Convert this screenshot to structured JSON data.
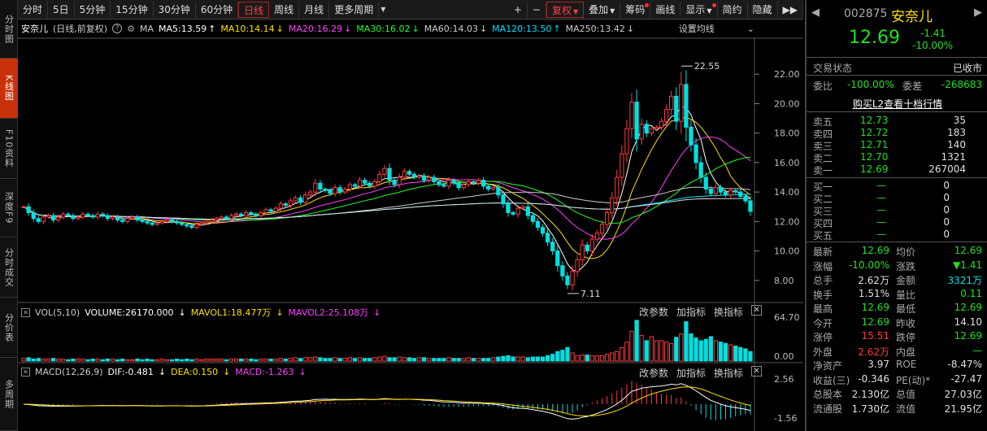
{
  "left_tabs": [
    {
      "label": "分时图",
      "active": false
    },
    {
      "label": "K线图",
      "active": true
    },
    {
      "label": "F10资料",
      "active": false
    },
    {
      "label": "深度F9",
      "active": false
    },
    {
      "label": "分时成交",
      "active": false
    },
    {
      "label": "分价表",
      "active": false
    },
    {
      "label": "多周期",
      "active": false
    }
  ],
  "toolbar": {
    "periods": [
      "分时",
      "5日",
      "5分钟",
      "15分钟",
      "30分钟",
      "60分钟",
      "日线",
      "周线",
      "月线",
      "更多周期"
    ],
    "active_period": "日线",
    "plus": "+",
    "minus": "−",
    "tools": [
      "复权",
      "叠加",
      "筹码",
      "画线",
      "显示",
      "简约",
      "隐藏"
    ],
    "expand": "▶▶"
  },
  "ma_legend": {
    "name": "安奈儿",
    "mode": "(日线,前复权)",
    "ma_label": "MA",
    "items": [
      {
        "text": "MA5:13.59",
        "arrow": "↑",
        "color": "#ffffff"
      },
      {
        "text": "MA10:14.14",
        "arrow": "↓",
        "color": "#ffe000"
      },
      {
        "text": "MA20:16.29",
        "arrow": "↓",
        "color": "#ff40ff"
      },
      {
        "text": "MA30:16.02",
        "arrow": "↓",
        "color": "#20ff20"
      },
      {
        "text": "MA60:14.03",
        "arrow": "↓",
        "color": "#cccccc"
      },
      {
        "text": "MA120:13.50",
        "arrow": "↑",
        "color": "#00e0ff"
      },
      {
        "text": "MA250:13.42",
        "arrow": "↓",
        "color": "#cccccc"
      }
    ],
    "settings": "设置均线"
  },
  "price_axis": [
    "22.00",
    "20.00",
    "18.00",
    "16.00",
    "14.00",
    "12.00",
    "10.00",
    "8.00"
  ],
  "annotations": {
    "high": "22.55",
    "low": "7.11"
  },
  "vol_panel": {
    "title": "VOL(5,10)",
    "volume": "VOLUME:26170.000",
    "mavol1": "MAVOL1:18.477万",
    "mavol2": "MAVOL2:25.108万",
    "axis_top": "64.70",
    "axis_bottom": "0.00"
  },
  "macd_panel": {
    "title": "MACD(12,26,9)",
    "dif": "DIF:-0.481",
    "dea": "DEA:0.150",
    "macd": "MACD:-1.263",
    "axis_top": "2.56",
    "axis_bottom": "-1.56"
  },
  "panel_buttons": [
    "改参数",
    "加指标",
    "换指标"
  ],
  "panel_close": "✕",
  "stock": {
    "code": "002875",
    "name": "安奈儿",
    "price": "12.69",
    "change": "-1.41",
    "pct": "-10.00%"
  },
  "status": {
    "label": "交易状态",
    "value": "已收市"
  },
  "weibi": {
    "label1": "委比",
    "val1": "-100.00%",
    "label2": "委差",
    "val2": "-268683"
  },
  "l2_button": "购买L2查看十档行情",
  "sell": [
    {
      "label": "卖五",
      "price": "12.73",
      "vol": "35"
    },
    {
      "label": "卖四",
      "price": "12.72",
      "vol": "183"
    },
    {
      "label": "卖三",
      "price": "12.71",
      "vol": "140"
    },
    {
      "label": "卖二",
      "price": "12.70",
      "vol": "1321"
    },
    {
      "label": "卖一",
      "price": "12.69",
      "vol": "267004"
    }
  ],
  "buy": [
    {
      "label": "买一",
      "price": "—",
      "vol": "0"
    },
    {
      "label": "买二",
      "price": "—",
      "vol": "0"
    },
    {
      "label": "买三",
      "price": "—",
      "vol": "0"
    },
    {
      "label": "买四",
      "price": "—",
      "vol": "0"
    },
    {
      "label": "买五",
      "price": "—",
      "vol": "0"
    }
  ],
  "stats": [
    [
      {
        "l": "最新",
        "v": "12.69",
        "c": "green"
      },
      {
        "l": "均价",
        "v": "12.69",
        "c": "green"
      }
    ],
    [
      {
        "l": "涨幅",
        "v": "-10.00%",
        "c": "green"
      },
      {
        "l": "涨跌",
        "v": "▼1.41",
        "c": "green"
      }
    ],
    [
      {
        "l": "总手",
        "v": "2.62万",
        "c": "white"
      },
      {
        "l": "金额",
        "v": "3321万",
        "c": "cyan"
      }
    ],
    [
      {
        "l": "换手",
        "v": "1.51%",
        "c": "white"
      },
      {
        "l": "量比",
        "v": "0.11",
        "c": "green"
      }
    ],
    [
      {
        "l": "最高",
        "v": "12.69",
        "c": "green"
      },
      {
        "l": "最低",
        "v": "12.69",
        "c": "green"
      }
    ],
    [
      {
        "l": "今开",
        "v": "12.69",
        "c": "green"
      },
      {
        "l": "昨收",
        "v": "14.10",
        "c": "white"
      }
    ],
    [
      {
        "l": "涨停",
        "v": "15.51",
        "c": "red"
      },
      {
        "l": "跌停",
        "v": "12.69",
        "c": "green"
      }
    ],
    [
      {
        "l": "外盘",
        "v": "2.62万",
        "c": "red"
      },
      {
        "l": "内盘",
        "v": "—",
        "c": "green"
      }
    ],
    [
      {
        "l": "净资产",
        "v": "3.97",
        "c": "white"
      },
      {
        "l": "ROE",
        "v": "-8.47%",
        "c": "white"
      }
    ],
    [
      {
        "l": "收益(三)",
        "v": "-0.346",
        "c": "white"
      },
      {
        "l": "PE(动)*",
        "v": "-27.47",
        "c": "white"
      }
    ],
    [
      {
        "l": "总股本",
        "v": "2.130亿",
        "c": "white"
      },
      {
        "l": "总值",
        "v": "27.03亿",
        "c": "white"
      }
    ],
    [
      {
        "l": "流通股",
        "v": "1.730亿",
        "c": "white"
      },
      {
        "l": "流值",
        "v": "21.95亿",
        "c": "white"
      }
    ]
  ],
  "colors": {
    "up": "#ff3b3b",
    "down": "#00e0e0",
    "accent": "#c8320a"
  },
  "chart_data": {
    "type": "candlestick",
    "ylim": [
      6.5,
      23.5
    ],
    "closes": [
      13.0,
      12.6,
      12.2,
      12.0,
      12.3,
      12.4,
      12.1,
      12.3,
      12.5,
      12.4,
      12.2,
      12.3,
      12.5,
      12.4,
      12.3,
      12.5,
      12.4,
      12.2,
      12.3,
      12.1,
      12.0,
      12.2,
      12.3,
      12.1,
      12.0,
      11.9,
      11.8,
      11.9,
      12.0,
      12.1,
      12.0,
      11.9,
      11.8,
      11.7,
      11.6,
      11.8,
      11.9,
      12.0,
      12.1,
      12.2,
      12.3,
      12.2,
      12.4,
      12.5,
      12.4,
      12.6,
      12.5,
      12.4,
      12.6,
      12.8,
      12.7,
      12.9,
      13.2,
      13.1,
      13.4,
      13.6,
      13.3,
      13.8,
      14.0,
      14.6,
      14.2,
      14.1,
      13.9,
      14.3,
      14.0,
      14.2,
      14.5,
      14.4,
      14.8,
      14.6,
      14.4,
      14.7,
      15.2,
      15.6,
      14.8,
      14.5,
      15.0,
      15.4,
      15.2,
      15.0,
      15.1,
      14.8,
      15.0,
      14.7,
      14.5,
      14.4,
      14.8,
      14.6,
      14.3,
      14.5,
      14.7,
      14.6,
      14.8,
      14.4,
      14.2,
      14.3,
      13.8,
      13.2,
      12.6,
      12.5,
      12.9,
      13.0,
      12.4,
      12.0,
      11.6,
      11.2,
      10.6,
      10.0,
      9.0,
      8.3,
      7.7,
      8.6,
      9.4,
      10.4,
      10.0,
      10.8,
      11.2,
      11.8,
      12.6,
      13.6,
      15.0,
      16.6,
      18.3,
      20.1,
      17.6,
      18.6,
      18.0,
      18.3,
      18.4,
      18.8,
      19.6,
      20.5,
      18.8,
      21.3,
      18.4,
      17.2,
      16.0,
      15.0,
      14.2,
      13.9,
      14.3,
      14.0,
      13.8,
      14.1,
      14.0,
      13.7,
      13.4,
      12.69
    ],
    "volumes": [
      4,
      5,
      3,
      4,
      3,
      3,
      4,
      3,
      3,
      2,
      3,
      3,
      3,
      2,
      3,
      3,
      2,
      3,
      3,
      2,
      3,
      2,
      2,
      3,
      2,
      3,
      2,
      2,
      3,
      2,
      2,
      3,
      2,
      3,
      2,
      3,
      2,
      3,
      3,
      3,
      3,
      2,
      3,
      3,
      3,
      3,
      3,
      2,
      3,
      3,
      3,
      3,
      4,
      3,
      4,
      5,
      4,
      5,
      5,
      6,
      5,
      4,
      4,
      5,
      4,
      4,
      5,
      4,
      5,
      4,
      4,
      5,
      6,
      7,
      5,
      5,
      6,
      5,
      5,
      4,
      5,
      5,
      4,
      4,
      4,
      4,
      5,
      4,
      4,
      4,
      5,
      4,
      4,
      4,
      4,
      5,
      6,
      7,
      8,
      6,
      6,
      6,
      5,
      6,
      6,
      6,
      8,
      10,
      14,
      16,
      20,
      12,
      8,
      9,
      9,
      8,
      8,
      8,
      10,
      12,
      14,
      20,
      28,
      44,
      60,
      38,
      30,
      36,
      30,
      30,
      28,
      26,
      35,
      40,
      58,
      40,
      34,
      30,
      32,
      36,
      30,
      28,
      26,
      24,
      22,
      20,
      18,
      14
    ],
    "macd_ylim": [
      -1.56,
      2.56
    ]
  }
}
